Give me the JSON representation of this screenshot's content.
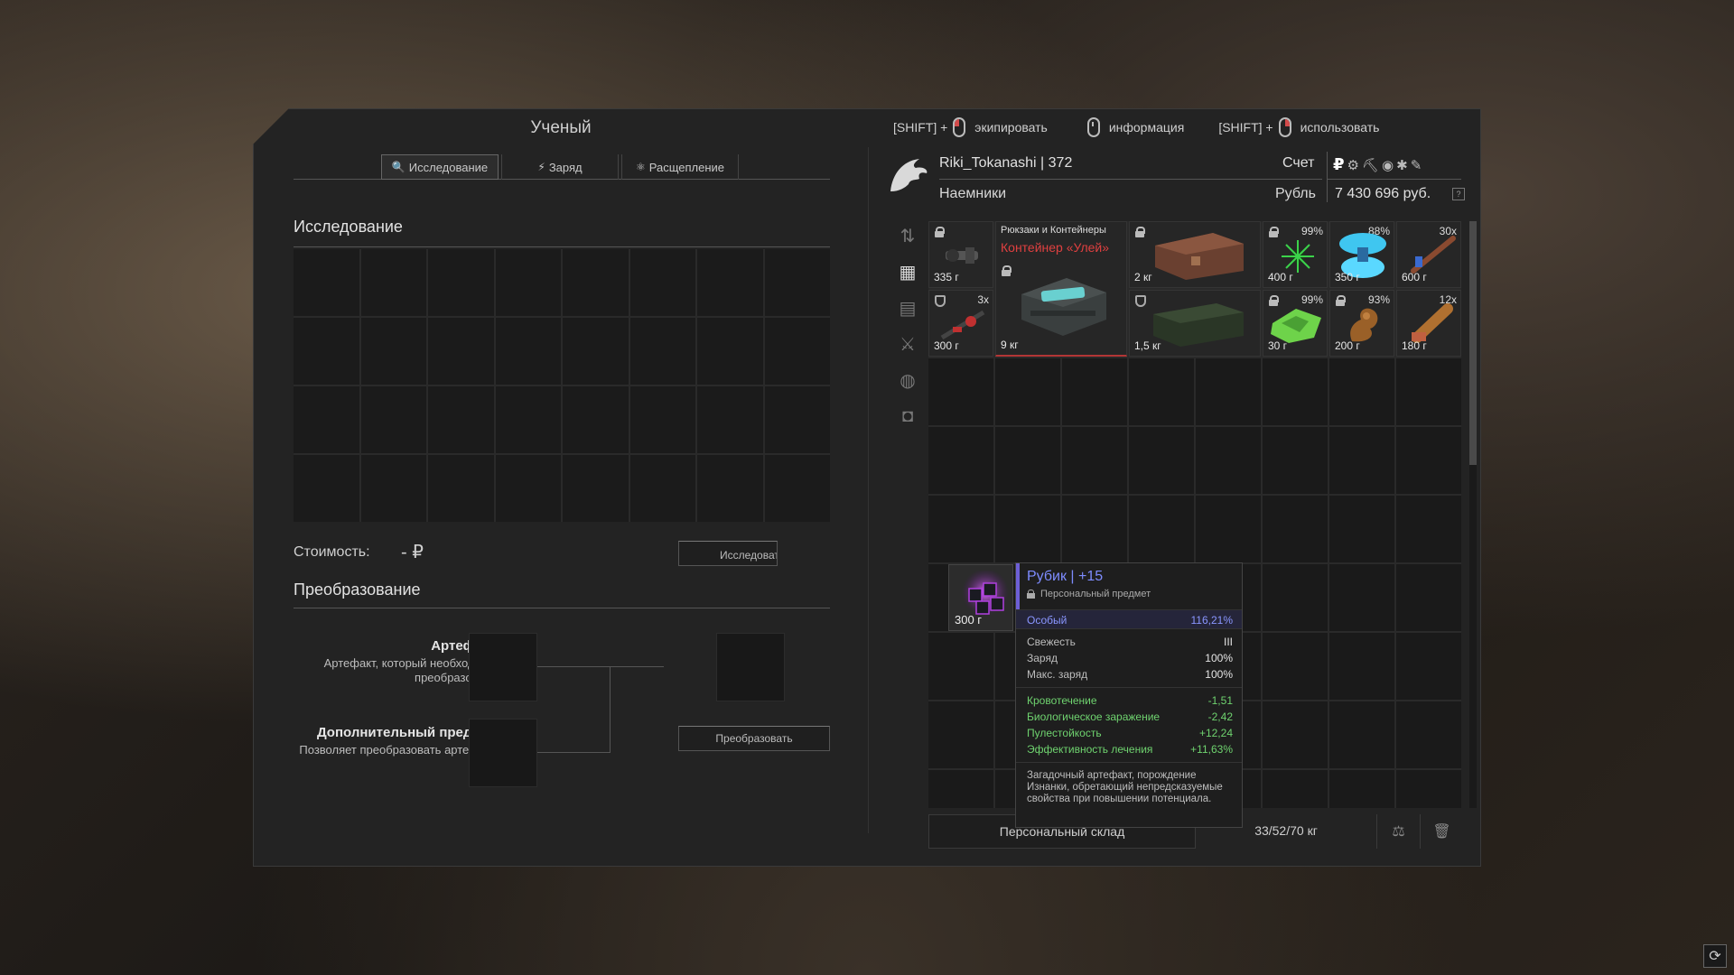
{
  "window": {
    "title": "Ученый"
  },
  "tabs": [
    {
      "label": "Исследование",
      "icon": "magnifier-icon",
      "glyph": "🔍"
    },
    {
      "label": "Заряд",
      "icon": "lightning-icon",
      "glyph": "⚡"
    },
    {
      "label": "Расщепление",
      "icon": "split-icon",
      "glyph": "⚛"
    }
  ],
  "research": {
    "title": "Исследование",
    "cost_label": "Стоимость:",
    "cost_value": "- ₽",
    "button_label": "Исследовать"
  },
  "transform": {
    "title": "Преобразование",
    "artifact_label": "Артефакт",
    "artifact_desc": "Артефакт, который необходимо преобразовать",
    "extra_label": "Дополнительный предмет",
    "extra_desc": "Позволяет преобразовать артефакт",
    "button_label": "Преобразовать"
  },
  "hints": [
    {
      "prefix": "[SHIFT] +",
      "mouse": "left",
      "label": "экипировать"
    },
    {
      "prefix": "",
      "mouse": "mid",
      "label": "информация"
    },
    {
      "prefix": "[SHIFT] +",
      "mouse": "right",
      "label": "использовать"
    }
  ],
  "player": {
    "name_level": "Riki_Tokanashi | 372",
    "faction": "Наемники",
    "account_label": "Счет",
    "currency_label": "Рубль",
    "money": "7 430 696 руб.",
    "currency_icons": [
      "ruble-icon",
      "gear-icon",
      "boot-icon",
      "coin-icon",
      "token-icon",
      "ticket-icon"
    ]
  },
  "categories": [
    "sort-icon",
    "grid-icon",
    "armor-icon",
    "weapon-icon",
    "artifact-icon",
    "camera-icon"
  ],
  "inventory_items": [
    {
      "name": "scope-item",
      "weight": "335 г",
      "badge": "",
      "locked": true
    },
    {
      "name": "backpack-container",
      "category": "Рюкзаки и Контейнеры",
      "title": "Контейнер «Улей»",
      "weight": "9 кг",
      "locked": true
    },
    {
      "name": "wooden-chest",
      "weight": "2 кг",
      "locked": true
    },
    {
      "name": "green-spiky-artifact",
      "weight": "400 г",
      "badge": "99%",
      "locked": true
    },
    {
      "name": "blue-crystal-artifact",
      "weight": "350 г",
      "badge": "88%"
    },
    {
      "name": "stick-item",
      "weight": "600 г",
      "badge": "30x"
    },
    {
      "name": "red-tool-item",
      "weight": "300 г",
      "badge": "3x",
      "shield": true
    },
    {
      "name": "green-crate",
      "weight": "1,5 кг",
      "shield": true
    },
    {
      "name": "green-map-artifact",
      "weight": "30 г",
      "badge": "99%",
      "locked": true
    },
    {
      "name": "brown-artifact",
      "weight": "200 г",
      "badge": "93%",
      "locked": true
    },
    {
      "name": "shell-item",
      "weight": "180 г",
      "badge": "12x"
    }
  ],
  "hover_item": {
    "weight": "300 г"
  },
  "tooltip": {
    "name": "Рубик | +15",
    "subtitle": "Персональный предмет",
    "rarity_label": "Особый",
    "rarity_value": "116,21%",
    "stats": [
      {
        "label": "Свежесть",
        "value": "III"
      },
      {
        "label": "Заряд",
        "value": "100%"
      },
      {
        "label": "Макс. заряд",
        "value": "100%"
      }
    ],
    "effects": [
      {
        "label": "Кровотечение",
        "value": "-1,51"
      },
      {
        "label": "Биологическое заражение",
        "value": "-2,42"
      },
      {
        "label": "Пулестойкость",
        "value": "+12,24"
      },
      {
        "label": "Эффективность лечения",
        "value": "+11,63%"
      }
    ],
    "description": "Загадочный артефакт, порождение Изнанки, обретающий непредсказуемые свойства при повышении потенциала."
  },
  "storage": {
    "tab_label": "Персональный склад",
    "weight": "33/52/70 кг"
  }
}
